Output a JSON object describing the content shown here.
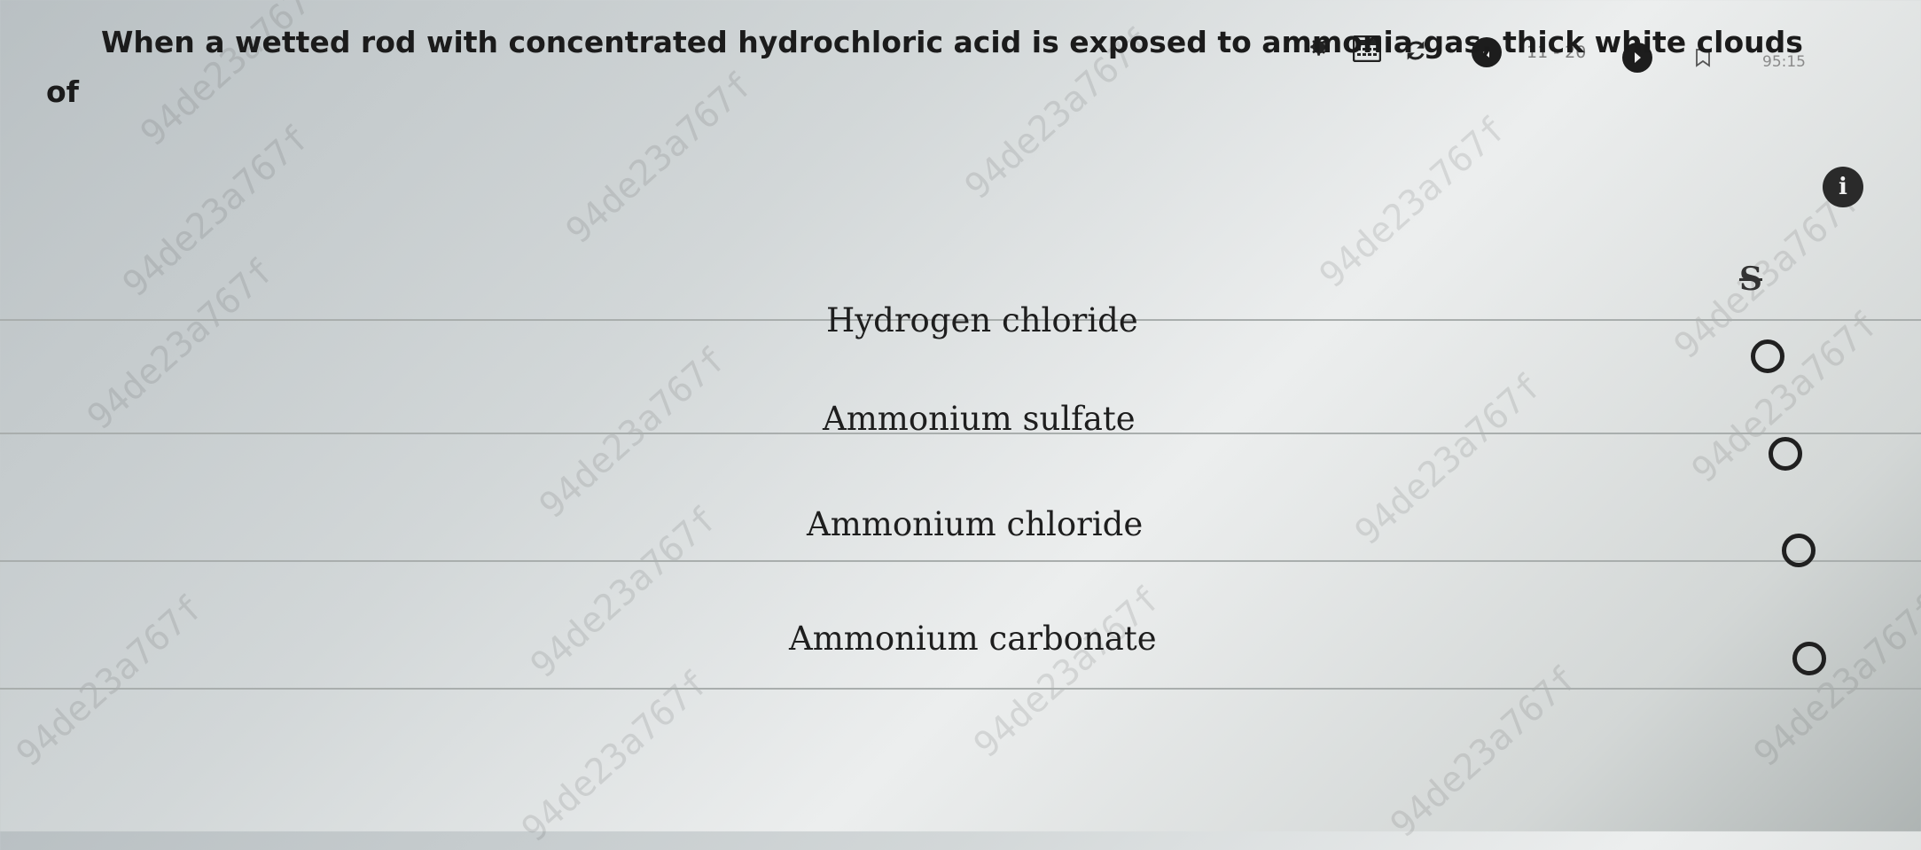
{
  "toolbar": {
    "settings_icon": "gear-icon",
    "calculator_icon": "calculator-icon",
    "refresh_icon": "refresh-icon",
    "prev_icon": "chevron-left-icon",
    "progress": "11 - 20",
    "next_icon": "chevron-right-icon",
    "bookmark_icon": "bookmark-icon",
    "timer": "95:15"
  },
  "question": {
    "line1": "When a wetted rod with concentrated hydrochloric acid is exposed to ammonia gas, thick white clouds",
    "line2": "of",
    "info_label": "i"
  },
  "tools": {
    "strike_label": "S"
  },
  "options": [
    {
      "label": "Hydrogen chloride"
    },
    {
      "label": "Ammonium sulfate"
    },
    {
      "label": "Ammonium chloride"
    },
    {
      "label": "Ammonium carbonate"
    }
  ],
  "watermark": "94de23a767f"
}
